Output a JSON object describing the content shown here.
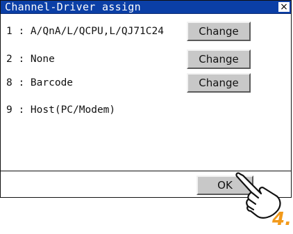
{
  "dialog": {
    "title": "Channel-Driver assign",
    "close_label": "×",
    "rows": [
      {
        "label": "1 : A/QnA/L/QCPU,L/QJ71C24",
        "has_button": true
      },
      {
        "label": "2 : None",
        "has_button": true
      },
      {
        "label": "8 : Barcode",
        "has_button": true
      },
      {
        "label": "9 : Host(PC/Modem)",
        "has_button": false
      }
    ],
    "change_label": "Change",
    "ok_label": "OK"
  },
  "annotation": {
    "step_number": "4.",
    "step_color": "#f29a1b",
    "pointer_icon": "pointing-hand-icon"
  },
  "colors": {
    "titlebar": "#0b3fa6",
    "button_face": "#c8c8c8"
  }
}
